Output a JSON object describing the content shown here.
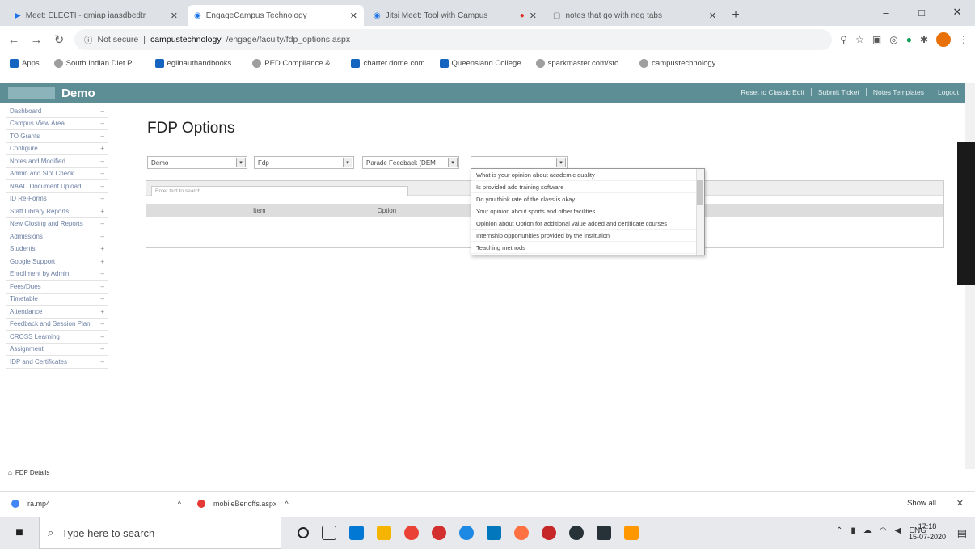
{
  "tabs": [
    {
      "title": "Meet: ELECTI - qmiap iaasdbedtr",
      "active": false
    },
    {
      "title": "EngageCampus Technology",
      "active": true
    },
    {
      "title": "Jitsi Meet: Tool with Campus",
      "active": false
    },
    {
      "title": "notes that go with neg tabs",
      "active": false
    }
  ],
  "window": {
    "minimize": "–",
    "maximize": "□",
    "close": "✕"
  },
  "address": {
    "secure_label": "Not secure",
    "host": "campustechnology",
    "path": "/engage/faculty/fdp_options.aspx"
  },
  "bookmarks": [
    "Apps",
    "South Indian Diet Pl...",
    "eglinauthandbooks...",
    "PED Compliance &...",
    "charter.dome.com",
    "Queensland College",
    "sparkmaster.com/sto...",
    "campustechnology..."
  ],
  "app": {
    "brand": "Demo",
    "top_links": [
      "Reset to Classic Edit",
      "Submit Ticket",
      "Notes Templates",
      "Logout"
    ]
  },
  "sidebar": [
    "Dashboard",
    "Campus View Area",
    "TO Grants",
    "Configure",
    "Notes and Modified",
    "Admin and Slot Check",
    "NAAC Document Upload",
    "ID Re-Forms",
    "Staff Library Reports",
    "New Closing and Reports",
    "Admissions",
    "Students",
    "Google Support",
    "Enrollment by Admin",
    "Fees/Dues",
    "Timetable",
    "Attendance",
    "Feedback and Session Plan",
    "CROSS Learning",
    "Assignment",
    "IDP and Certificates"
  ],
  "sidebar_footer": "FDP Details",
  "page": {
    "title": "FDP Options"
  },
  "filters": {
    "sel1": "Demo",
    "sel2": "Fdp",
    "sel3": "Parade Feedback (DEM",
    "sel4": ""
  },
  "search_placeholder": "Enter text to search...",
  "table_headers": [
    "Item",
    "Option"
  ],
  "dropdown_options": [
    "What is your opinion about academic quality",
    "Is provided add training software",
    "Do you think rate of the class is okay",
    "Your opinion about sports and other facilities",
    "Opinion about Option for additional value added and certificate courses",
    "Internship opportunities provided by the institution",
    "Teaching methods"
  ],
  "downloads": [
    {
      "name": "ra.mp4",
      "color": "#4285f4"
    },
    {
      "name": "mobileBenoffs.aspx",
      "color": "#e53935"
    }
  ],
  "downloads_show_all": "Show all",
  "taskbar": {
    "search_placeholder": "Type here to search",
    "language": "ENG",
    "time": "17:18",
    "date": "15-07-2020"
  },
  "taskbar_icon_colors": [
    "#0078d4",
    "#f5b400",
    "#ea4335",
    "#d32f2f",
    "#1e88e5",
    "#0277bd",
    "#ff7043",
    "#c62828",
    "#263238",
    "#ff9800"
  ]
}
